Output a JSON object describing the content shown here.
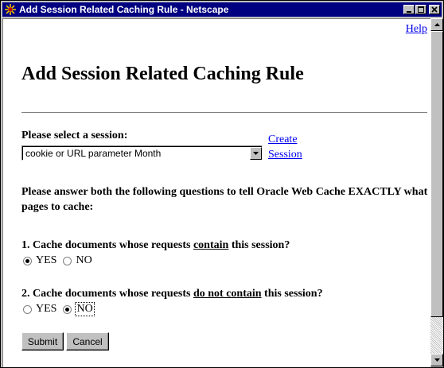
{
  "window": {
    "title": "Add Session Related Caching Rule - Netscape",
    "app_icon": "netscape-icon",
    "controls": {
      "minimize": "minimize-icon",
      "maximize": "maximize-icon",
      "close": "close-icon"
    }
  },
  "page": {
    "help_link": "Help",
    "heading": "Add Session Related Caching Rule",
    "session_label": "Please select a session:",
    "session_selected": "cookie or URL parameter Month",
    "create_link_line1": "Create",
    "create_link_line2": "Session",
    "instructions": "Please answer both the following questions to tell Oracle Web Cache EXACTLY what pages to cache:",
    "q1": {
      "prefix": "1. Cache documents whose requests ",
      "emph": "contain",
      "suffix": " this session?",
      "yes": "YES",
      "no": "NO",
      "selected": "YES"
    },
    "q2": {
      "prefix": "2. Cache documents whose requests ",
      "emph": "do not contain",
      "suffix": " this session?",
      "yes": "YES",
      "no": "NO",
      "selected": "NO"
    },
    "submit": "Submit",
    "cancel": "Cancel"
  },
  "colors": {
    "titlebar": "#000080",
    "link": "#0000ee",
    "chrome": "#c0c0c0"
  }
}
